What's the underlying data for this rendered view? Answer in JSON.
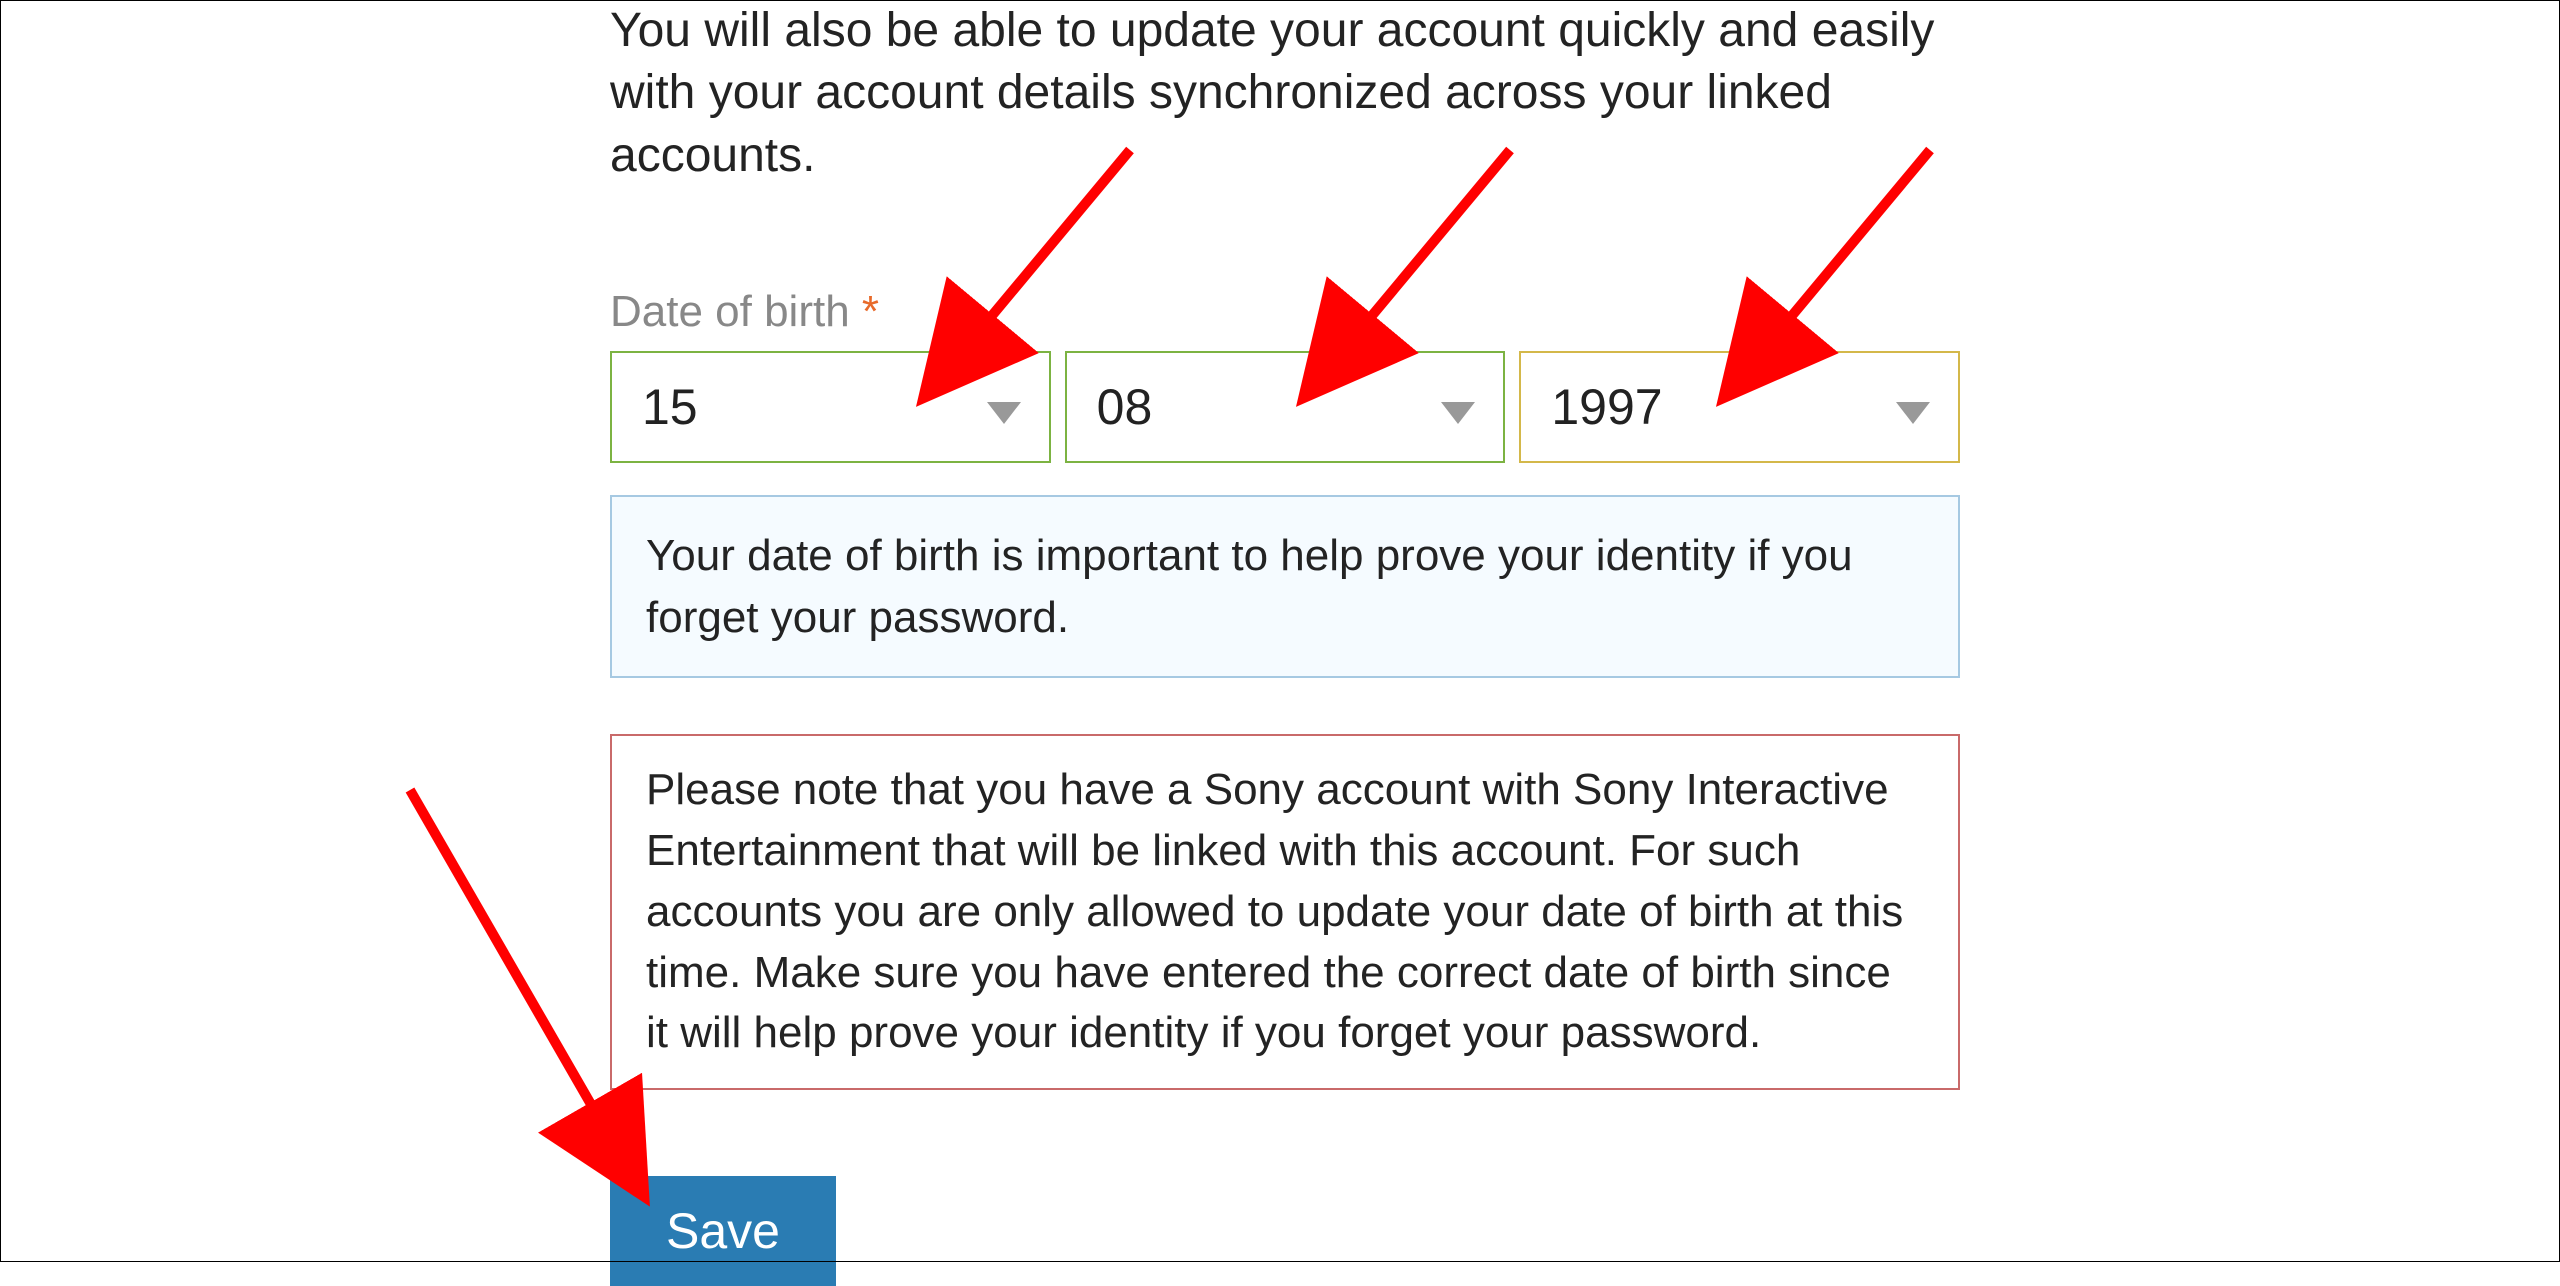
{
  "intro": "You will also be able to update your account quickly and easily with your account details synchronized across your linked accounts.",
  "dob": {
    "label": "Date of birth",
    "required_marker": "*",
    "day": "15",
    "month": "08",
    "year": "1997"
  },
  "info_message": "Your date of birth is important to help prove your identity if you forget your password.",
  "warning_message": "Please note that you have a Sony account with Sony Interactive Entertainment that will be linked with this account. For such accounts you are only allowed to update your date of birth at this time. Make sure you have entered the correct date of birth since it will help prove your identity if you forget your password.",
  "buttons": {
    "save": "Save"
  },
  "colors": {
    "accent_blue": "#2a7cb3",
    "border_green": "#7cb342",
    "border_yellow": "#d4b84a",
    "info_border": "#a6c9e2",
    "warning_border": "#c96a6a",
    "required": "#e86a2a",
    "annotation_arrow": "#ff0000"
  }
}
